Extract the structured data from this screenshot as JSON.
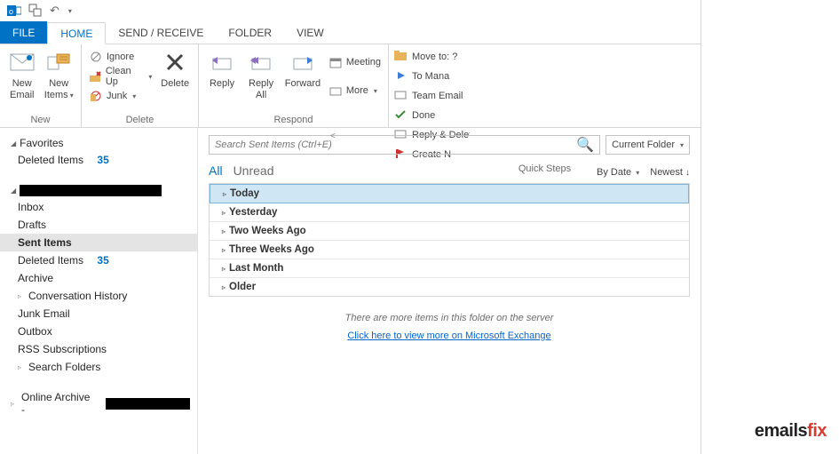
{
  "tabs": {
    "file": "FILE",
    "home": "HOME",
    "sendreceive": "SEND / RECEIVE",
    "folder": "FOLDER",
    "view": "VIEW"
  },
  "ribbon": {
    "new": {
      "email": "New\nEmail",
      "items": "New\nItems",
      "label": "New"
    },
    "delete": {
      "ignore": "Ignore",
      "cleanup": "Clean Up",
      "junk": "Junk",
      "delete": "Delete",
      "label": "Delete"
    },
    "respond": {
      "reply": "Reply",
      "replyall": "Reply\nAll",
      "forward": "Forward",
      "meeting": "Meeting",
      "more": "More",
      "label": "Respond"
    },
    "quicksteps": {
      "moveto": "Move to: ?",
      "team": "Team Email",
      "replydel": "Reply & Delete",
      "tomanager": "To Mana",
      "done": "Done",
      "createnew": "Create N",
      "label": "Quick Steps"
    }
  },
  "sidebar": {
    "favorites": "Favorites",
    "fav_deleted": "Deleted Items",
    "fav_deleted_count": "35",
    "inbox": "Inbox",
    "drafts": "Drafts",
    "sent": "Sent Items",
    "deleted": "Deleted Items",
    "deleted_count": "35",
    "archive": "Archive",
    "conv": "Conversation History",
    "junk": "Junk Email",
    "outbox": "Outbox",
    "rss": "RSS Subscriptions",
    "search": "Search Folders",
    "online": "Online Archive -"
  },
  "search": {
    "placeholder": "Search Sent Items (Ctrl+E)",
    "scope": "Current Folder"
  },
  "filters": {
    "all": "All",
    "unread": "Unread",
    "bydate": "By Date",
    "newest": "Newest"
  },
  "groups": [
    "Today",
    "Yesterday",
    "Two Weeks Ago",
    "Three Weeks Ago",
    "Last Month",
    "Older"
  ],
  "more_note": "There are more items in this folder on the server",
  "more_link": "Click here to view more on Microsoft Exchange",
  "watermark": {
    "a": "emails",
    "b": "fix"
  }
}
